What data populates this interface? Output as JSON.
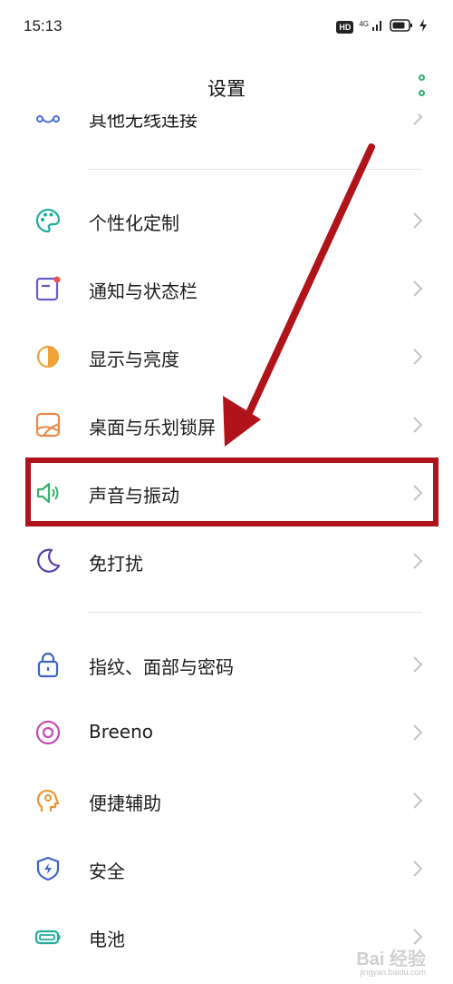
{
  "status_bar": {
    "time": "15:13",
    "hd": "HD",
    "network": "4G"
  },
  "app_bar": {
    "title": "设置"
  },
  "settings": {
    "items": [
      {
        "label": "其他无线连接",
        "icon": "link-icon"
      },
      {
        "label": "个性化定制",
        "icon": "palette-icon"
      },
      {
        "label": "通知与状态栏",
        "icon": "notification-icon"
      },
      {
        "label": "显示与亮度",
        "icon": "brightness-icon"
      },
      {
        "label": "桌面与乐划锁屏",
        "icon": "wallpaper-icon"
      },
      {
        "label": "声音与振动",
        "icon": "speaker-icon"
      },
      {
        "label": "免打扰",
        "icon": "moon-icon"
      },
      {
        "label": "指纹、面部与密码",
        "icon": "lock-icon"
      },
      {
        "label": "Breeno",
        "icon": "breeno-icon"
      },
      {
        "label": "便捷辅助",
        "icon": "assist-icon"
      },
      {
        "label": "安全",
        "icon": "shield-icon"
      },
      {
        "label": "电池",
        "icon": "battery-icon"
      }
    ]
  },
  "watermark": {
    "text": "Bai 经验",
    "sub": "jingyan.baidu.com"
  },
  "colors": {
    "accent": "#2bb56e",
    "highlight": "#b0131a"
  }
}
